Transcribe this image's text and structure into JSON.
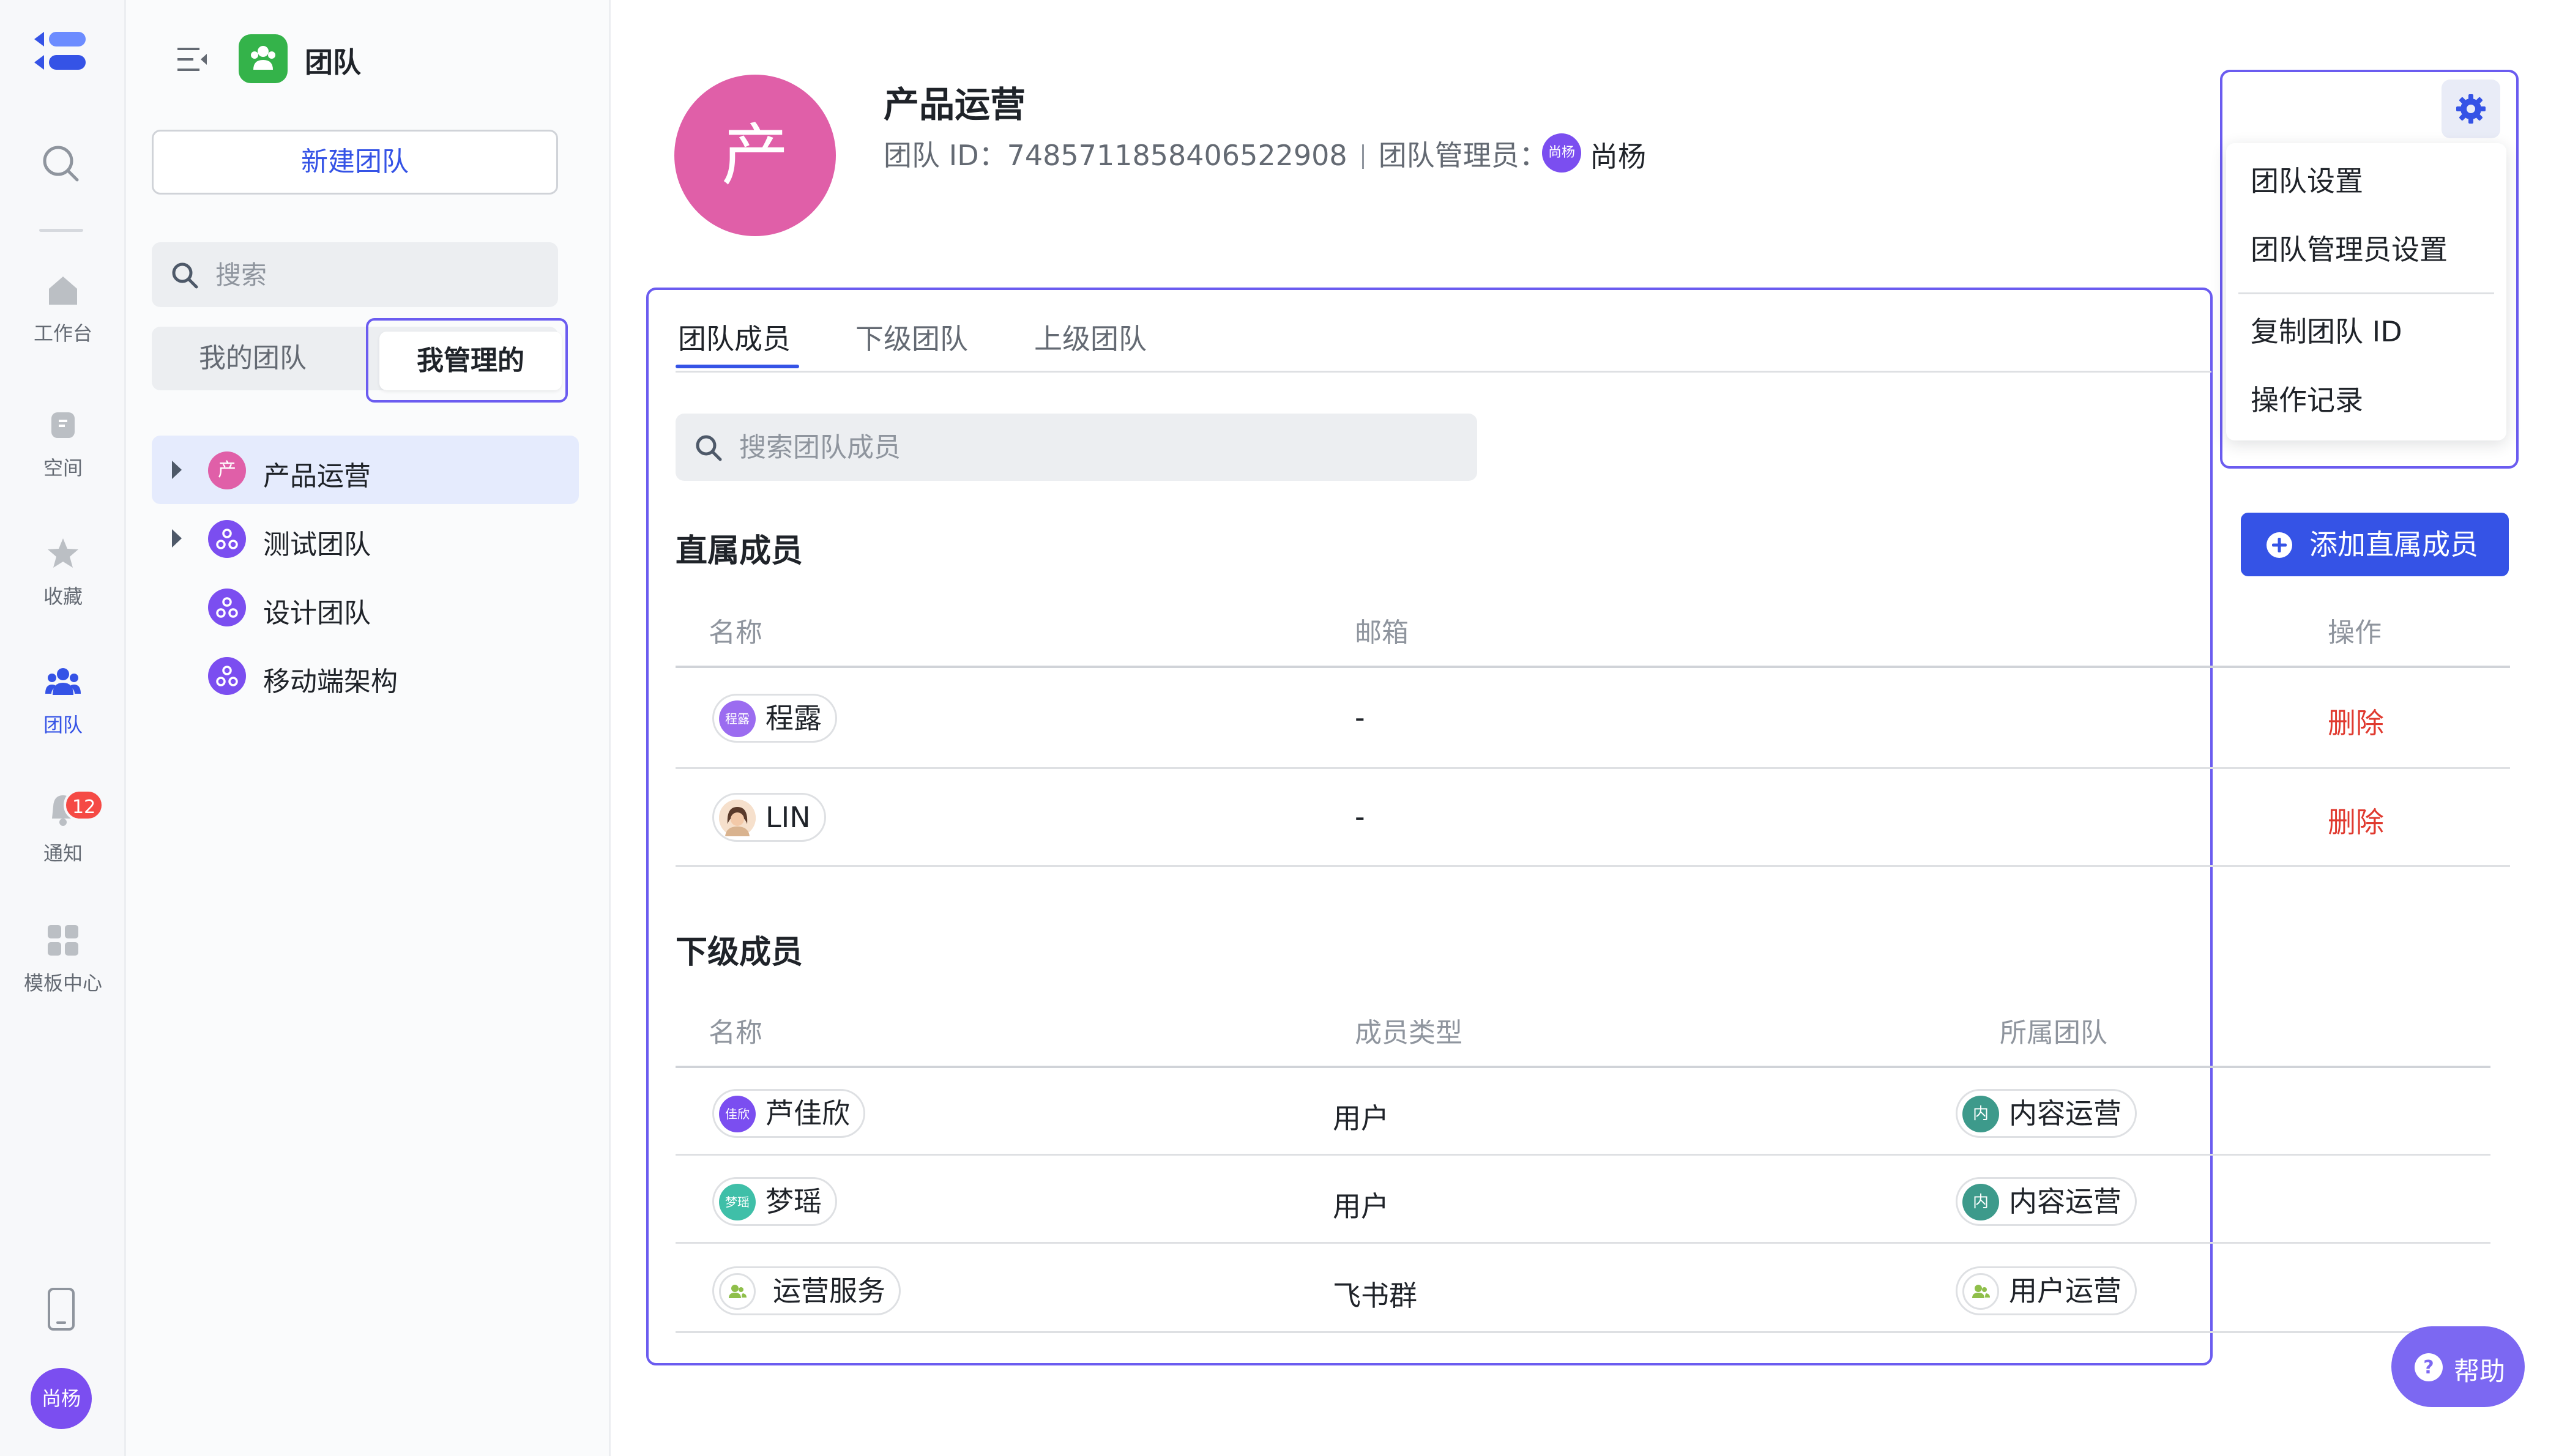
{
  "rail": {
    "items": [
      {
        "label": "工作台",
        "icon": "home-icon"
      },
      {
        "label": "空间",
        "icon": "space-icon"
      },
      {
        "label": "收藏",
        "icon": "star-icon"
      },
      {
        "label": "团队",
        "icon": "team-icon",
        "active": true
      },
      {
        "label": "通知",
        "icon": "bell-icon",
        "badge": "12"
      },
      {
        "label": "模板中心",
        "icon": "template-icon"
      }
    ],
    "user_avatar": "尚杨"
  },
  "panel": {
    "title": "团队",
    "new_team": "新建团队",
    "search_placeholder": "搜索",
    "seg_mine": "我的团队",
    "seg_managed": "我管理的",
    "tree": [
      {
        "avatar": "产",
        "label": "产品运营",
        "color": "#e05fa8"
      },
      {
        "label": "测试团队",
        "color": "#7b4ef0"
      },
      {
        "label": "设计团队",
        "color": "#7b4ef0"
      },
      {
        "label": "移动端架构",
        "color": "#7b4ef0"
      }
    ]
  },
  "team": {
    "avatar": "产",
    "name": "产品运营",
    "id_text": "团队 ID：7485711858406522908",
    "admin_label": "团队管理员：",
    "admin_avatar": "尚杨",
    "admin_name": "尚杨"
  },
  "tabs": [
    "团队成员",
    "下级团队",
    "上级团队"
  ],
  "member_search_placeholder": "搜索团队成员",
  "direct": {
    "title": "直属成员",
    "headers": {
      "name": "名称",
      "email": "邮箱",
      "action": "操作"
    },
    "rows": [
      {
        "avatar": "程露",
        "name": "程露",
        "email": "-",
        "action": "删除"
      },
      {
        "avatar": "",
        "name": "LIN",
        "email": "-",
        "action": "删除"
      }
    ]
  },
  "sub": {
    "title": "下级成员",
    "headers": {
      "name": "名称",
      "type": "成员类型",
      "team": "所属团队"
    },
    "rows": [
      {
        "avatar": "佳欣",
        "name": "芦佳欣",
        "type": "用户",
        "team_avatar": "内",
        "team": "内容运营"
      },
      {
        "avatar": "梦瑶",
        "name": "梦瑶",
        "type": "用户",
        "team_avatar": "内",
        "team": "内容运营"
      },
      {
        "avatar": "",
        "name": "运营服务",
        "type": "飞书群",
        "team_avatar": "",
        "team": "用户运营"
      }
    ]
  },
  "add_button": "添加直属成员",
  "menu": [
    "团队设置",
    "团队管理员设置",
    "复制团队 ID",
    "操作记录"
  ],
  "help": "帮助",
  "colors": {
    "accent": "#3553e6",
    "danger": "#e03a2f",
    "highlight": "#6b5cf0"
  }
}
